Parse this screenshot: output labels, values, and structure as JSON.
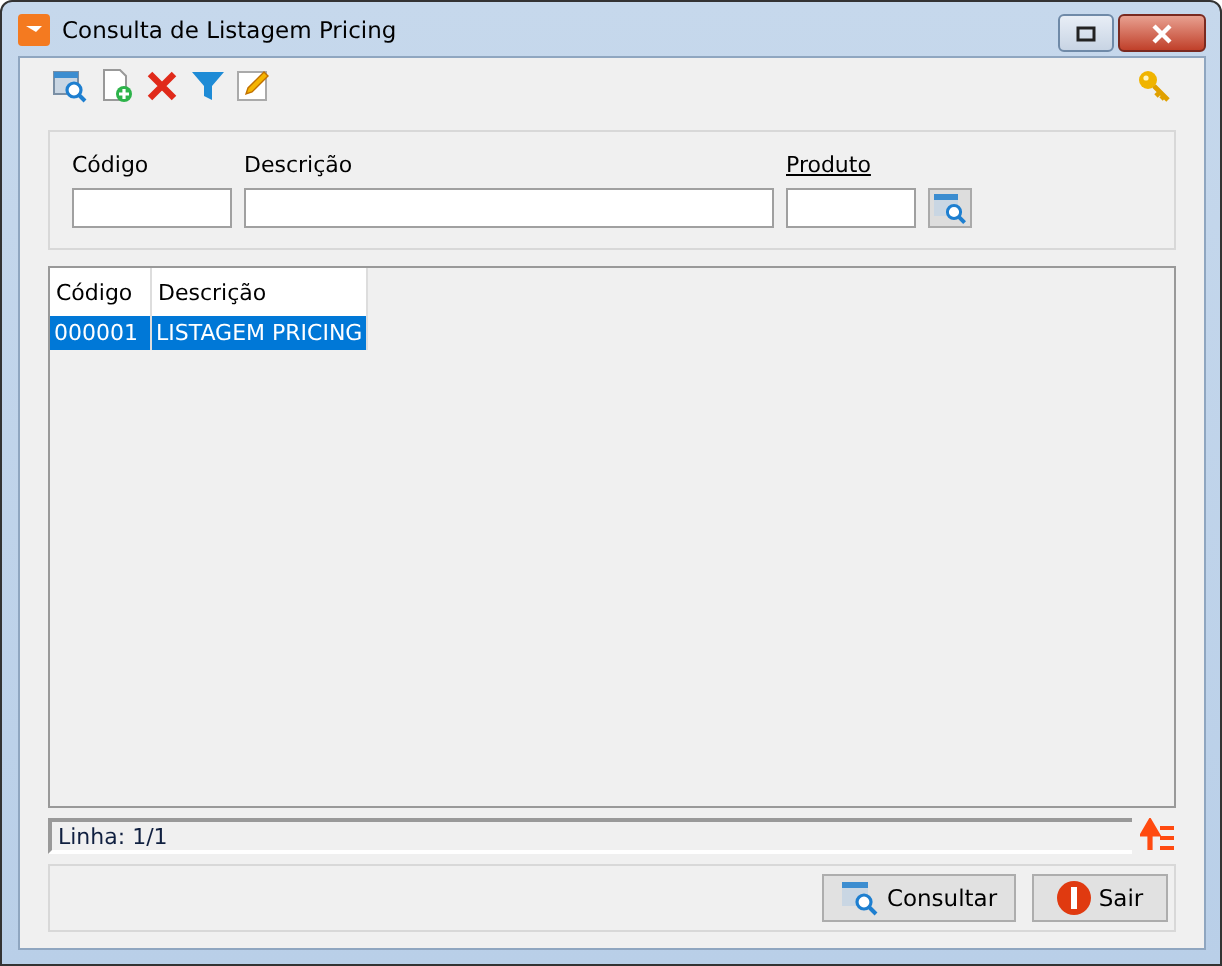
{
  "window": {
    "title": "Consulta de Listagem Pricing"
  },
  "filters": [
    {
      "label": "Código",
      "kind": "field",
      "underlined": false
    },
    {
      "label": "Descrição",
      "kind": "field",
      "underlined": false
    },
    {
      "label": "Produto",
      "kind": "lookup",
      "underlined": true
    }
  ],
  "table": {
    "columns": [
      "Código",
      "Descrição"
    ],
    "rows": [
      {
        "cells": [
          "000001",
          "LISTAGEM PRICING"
        ],
        "selected": true
      }
    ]
  },
  "status_bar": {
    "text": "Linha: 1/1"
  },
  "buttons": [
    {
      "label": "Consultar",
      "kind": "search"
    },
    {
      "label": "Sair",
      "kind": "exit"
    }
  ]
}
